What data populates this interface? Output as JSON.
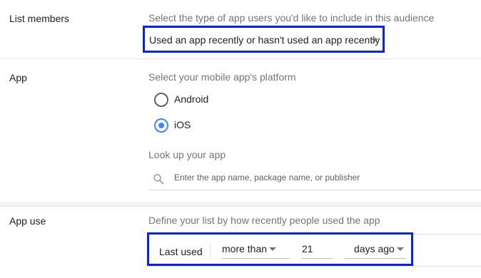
{
  "list_members": {
    "title": "List members",
    "hint": "Select the type of app users you'd like to include in this audience",
    "dropdown_value": "Used an app recently or hasn't used an app recently"
  },
  "app": {
    "title": "App",
    "platform_hint": "Select your mobile app's platform",
    "platforms": [
      {
        "label": "Android",
        "selected": false
      },
      {
        "label": "iOS",
        "selected": true
      }
    ],
    "lookup_label": "Look up your app",
    "search_placeholder": "Enter the app name, package name, or publisher"
  },
  "app_use": {
    "title": "App use",
    "hint": "Define your list by how recently people used the app",
    "last_used_label": "Last used",
    "comparator": "more than",
    "days_value": "21",
    "unit": "days ago"
  },
  "colors": {
    "highlight": "#0d23d6",
    "radio_selected": "#4285f4"
  }
}
